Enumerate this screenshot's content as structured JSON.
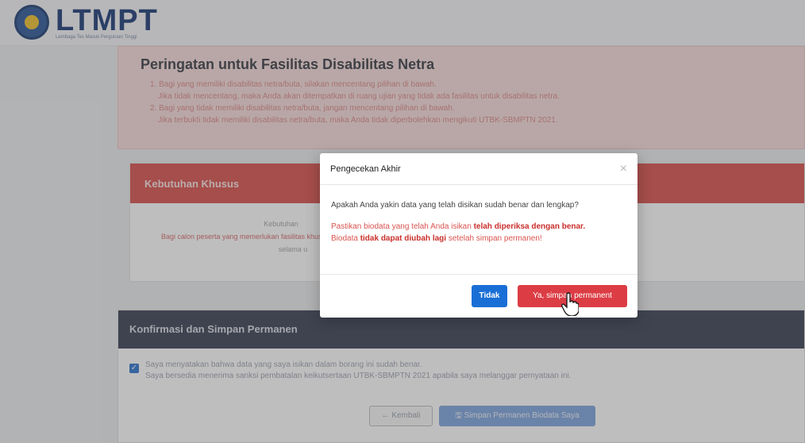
{
  "header": {
    "logo_title": "LTMPT",
    "logo_subtitle": "Lembaga Tes Masuk Perguruan Tinggi"
  },
  "warning": {
    "title": "Peringatan untuk Fasilitas Disabilitas Netra",
    "items": [
      "1. Bagi yang memiliki disabilitas netra/buta, silakan mencentang pilihan di bawah.",
      "Jika tidak mencentang, maka Anda akan ditempatkan di ruang ujian yang tidak ada fasilitas untuk disabilitas netra.",
      "2. Bagi yang tidak memiliki disabilitas netra/buta, jangan mencentang pilihan di bawah.",
      "Jika terbukti tidak memiliki disabilitas netra/buta, maka Anda tidak diperbolehkan mengikuti UTBK-SBMPTN 2021."
    ]
  },
  "special_needs": {
    "title": "Kebutuhan Khusus",
    "line1": "Kebutuhan",
    "line2": "Bagi calon peserta yang memerlukan fasilitas khusus",
    "line3": "selama u"
  },
  "confirm": {
    "title": "Konfirmasi dan Simpan Permanen",
    "check_line1": "Saya menyatakan bahwa data yang saya isikan dalam borang ini sudah benar.",
    "check_line2": "Saya bersedia menerima sanksi pembatalan keikutsertaan UTBK-SBMPTN 2021 apabila saya melanggar pernyataan ini.",
    "back_label": "← Kembali",
    "save_label": "🖫 Simpan Permanen Biodata Saya"
  },
  "modal": {
    "title": "Pengecekan Akhir",
    "close": "×",
    "question": "Apakah Anda yakin data yang telah disikan sudah benar dan lengkap?",
    "note_line1_prefix": "Pastikan biodata yang telah Anda isikan ",
    "note_line1_bold": "telah diperiksa dengan benar.",
    "note_line2_prefix": "Biodata ",
    "note_line2_bold": "tidak dapat diubah lagi",
    "note_line2_suffix": " setelah simpan permanen!",
    "no_label": "Tidak",
    "yes_label": "Ya, simpan permanent"
  },
  "colors": {
    "danger": "#dc3d45",
    "primary": "#1a6fd6",
    "dark_header": "#3d4356"
  },
  "icons": {
    "close": "close-icon",
    "cursor": "hand-pointer-icon",
    "back": "arrow-left-icon",
    "save": "save-icon"
  }
}
